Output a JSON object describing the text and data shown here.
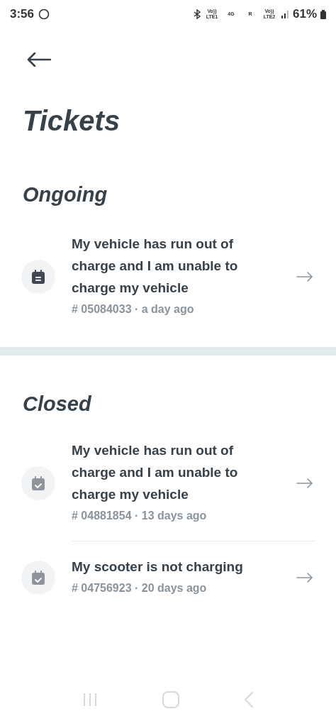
{
  "status_bar": {
    "time": "3:56",
    "network": [
      "Vo)) LTE1",
      "4G",
      "R",
      "Vo)) LTE2"
    ],
    "battery": "61%"
  },
  "title": "Tickets",
  "sections": [
    {
      "heading": "Ongoing",
      "tickets": [
        {
          "kind": "open",
          "subject": "My vehicle has run out of charge and I am unable to charge my vehicle",
          "meta": "# 05084033 · a day ago"
        }
      ]
    },
    {
      "heading": "Closed",
      "tickets": [
        {
          "kind": "closed",
          "subject": "My vehicle has run out of charge and I am unable to charge my vehicle",
          "meta": "# 04881854 · 13 days ago"
        },
        {
          "kind": "closed",
          "subject": "My scooter is not charging",
          "meta": "# 04756923 · 20 days ago"
        }
      ]
    }
  ]
}
